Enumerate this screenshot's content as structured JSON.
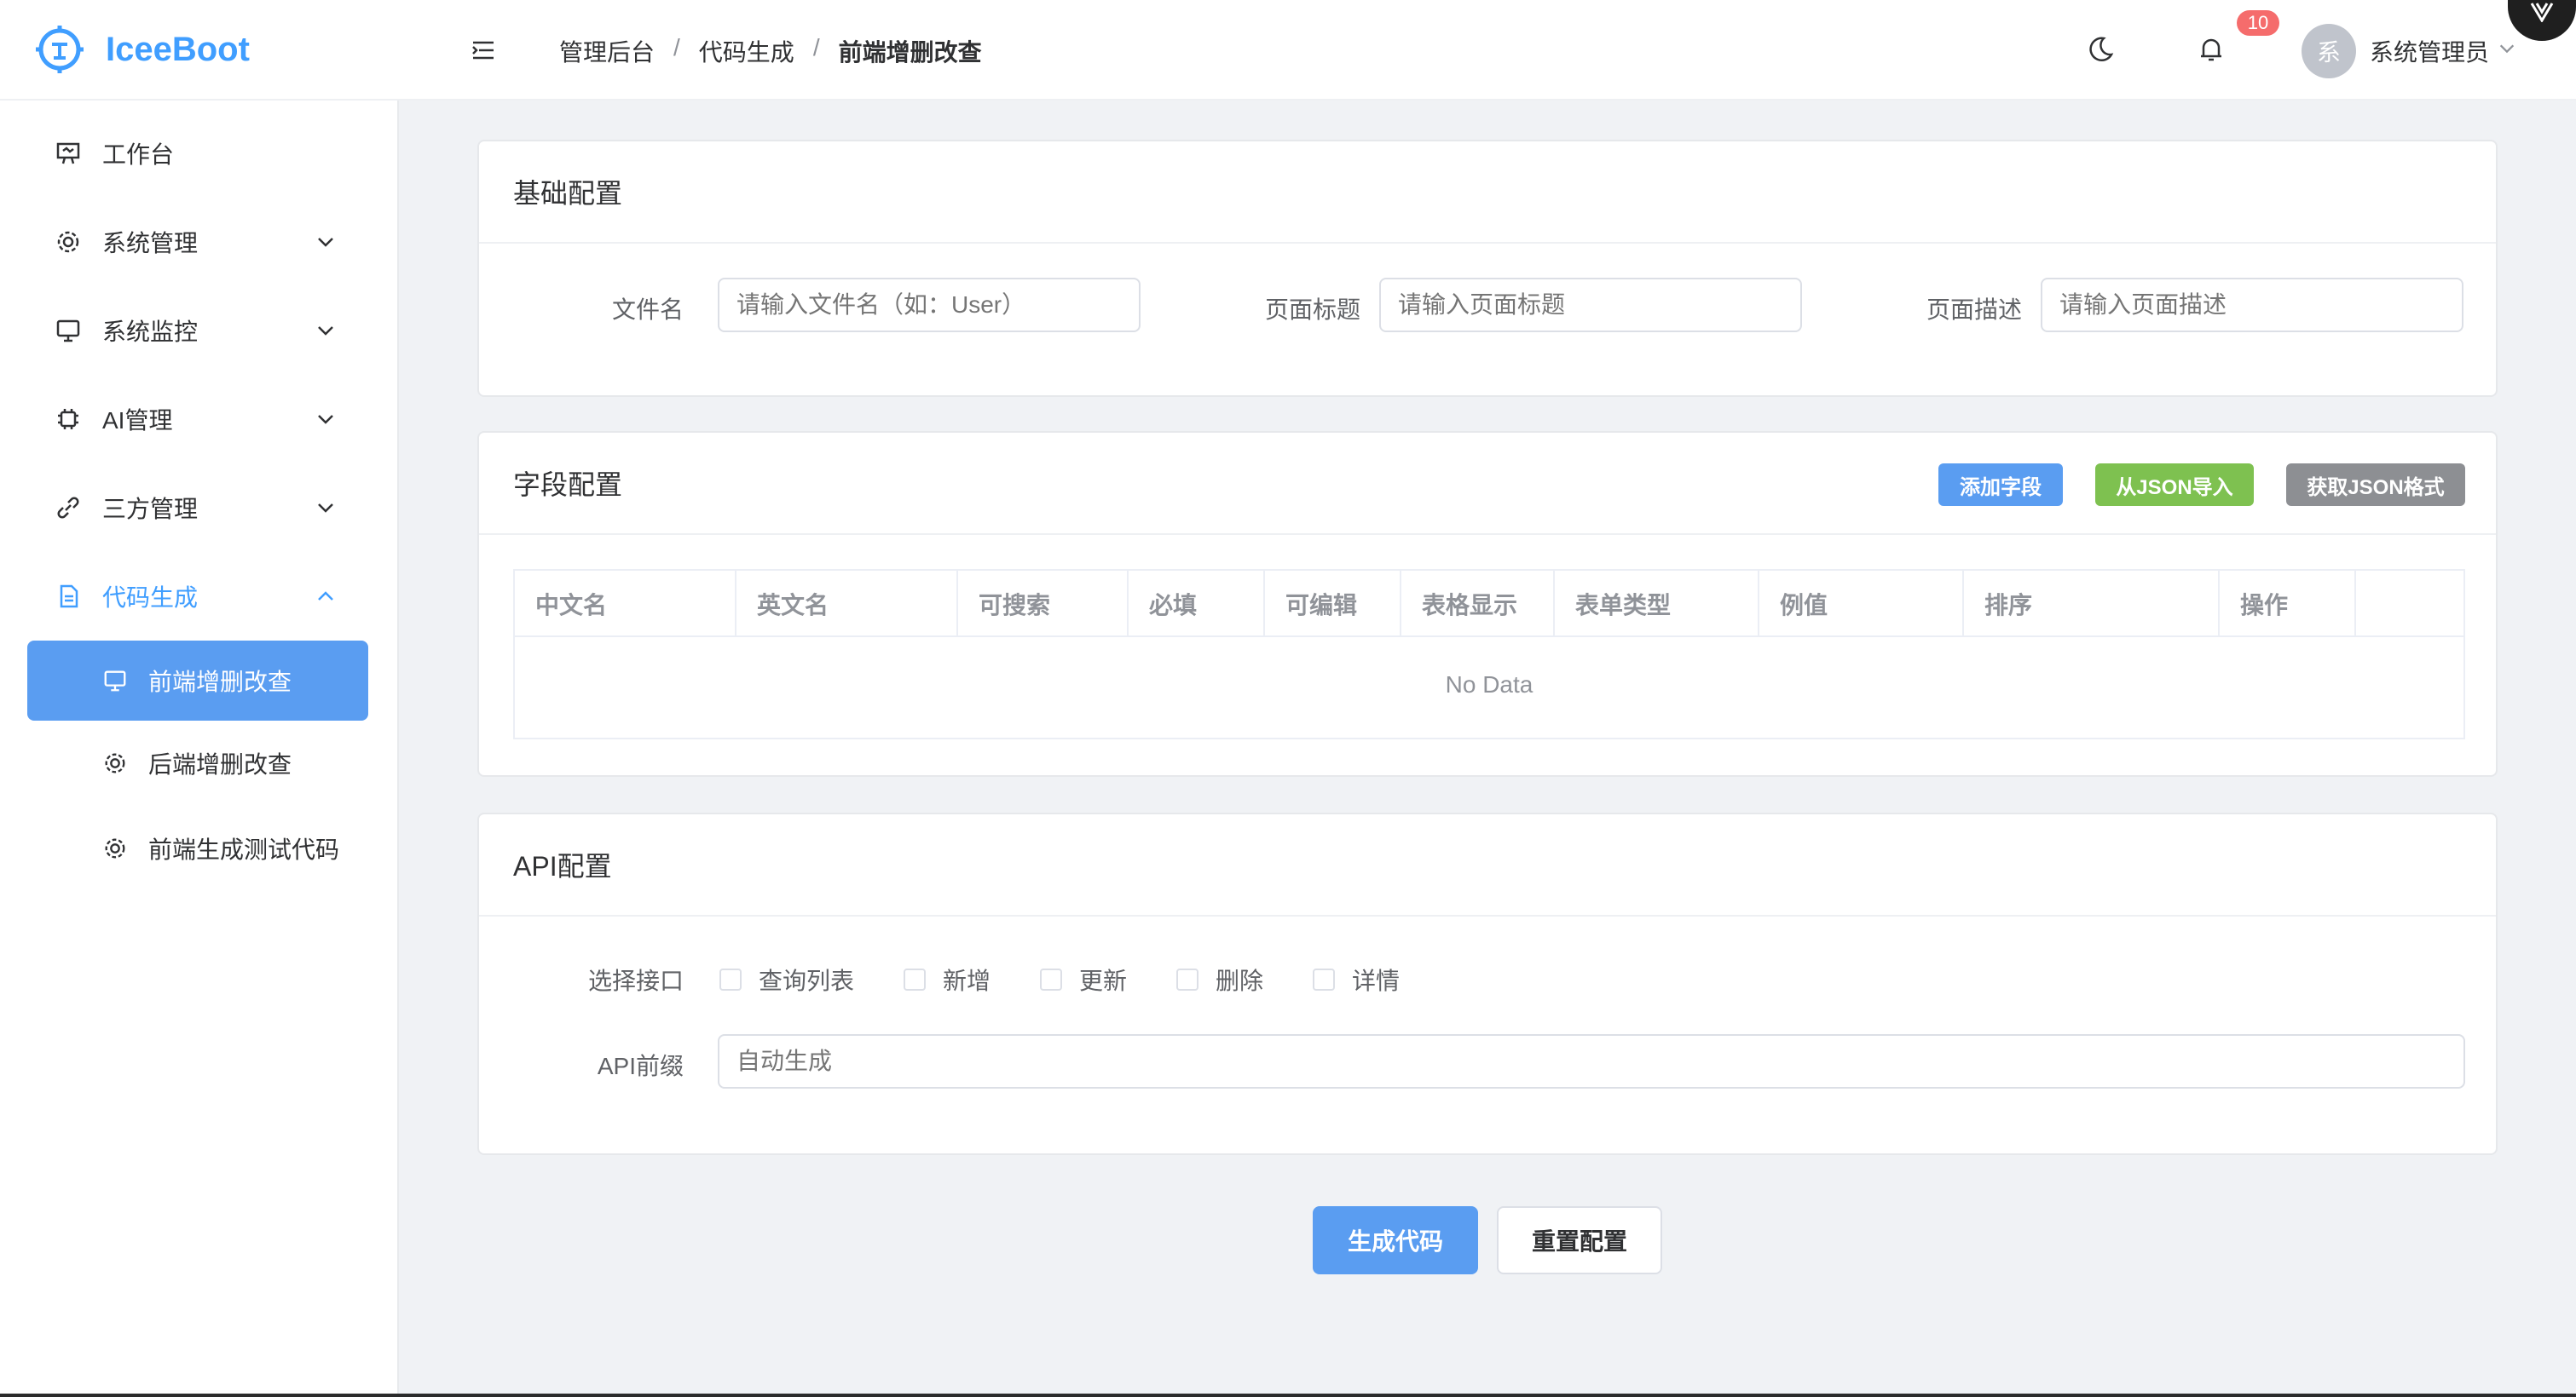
{
  "app": {
    "name": "IceeBoot"
  },
  "sidebar": {
    "items": [
      {
        "label": "工作台",
        "icon": "dashboard-icon"
      },
      {
        "label": "系统管理",
        "icon": "gear-icon"
      },
      {
        "label": "系统监控",
        "icon": "monitor-icon"
      },
      {
        "label": "AI管理",
        "icon": "chip-icon"
      },
      {
        "label": "三方管理",
        "icon": "link-icon"
      },
      {
        "label": "代码生成",
        "icon": "document-icon"
      }
    ],
    "subitems": [
      {
        "label": "前端增删改查",
        "icon": "monitor-icon"
      },
      {
        "label": "后端增删改查",
        "icon": "gear-icon"
      },
      {
        "label": "前端生成测试代码",
        "icon": "gear-icon"
      }
    ]
  },
  "header": {
    "breadcrumb": [
      "管理后台",
      "代码生成",
      "前端增删改查"
    ],
    "notification_count": "10",
    "avatar_text": "系",
    "username": "系统管理员"
  },
  "basic": {
    "title": "基础配置",
    "filename_label": "文件名",
    "filename_placeholder": "请输入文件名（如：User）",
    "page_title_label": "页面标题",
    "page_title_placeholder": "请输入页面标题",
    "page_desc_label": "页面描述",
    "page_desc_placeholder": "请输入页面描述"
  },
  "fields": {
    "title": "字段配置",
    "add_button": "添加字段",
    "import_button": "从JSON导入",
    "get_json_button": "获取JSON格式",
    "columns": [
      "中文名",
      "英文名",
      "可搜索",
      "必填",
      "可编辑",
      "表格显示",
      "表单类型",
      "例值",
      "排序",
      "操作"
    ],
    "empty_text": "No Data"
  },
  "api": {
    "title": "API配置",
    "select_label": "选择接口",
    "options": [
      "查询列表",
      "新增",
      "更新",
      "删除",
      "详情"
    ],
    "prefix_label": "API前缀",
    "prefix_placeholder": "自动生成"
  },
  "actions": {
    "generate": "生成代码",
    "reset": "重置配置"
  },
  "colors": {
    "primary": "#409eff",
    "active_menu_bg": "#5a9df1",
    "success": "#67c23a",
    "info": "#909399",
    "danger": "#f56c6c"
  }
}
